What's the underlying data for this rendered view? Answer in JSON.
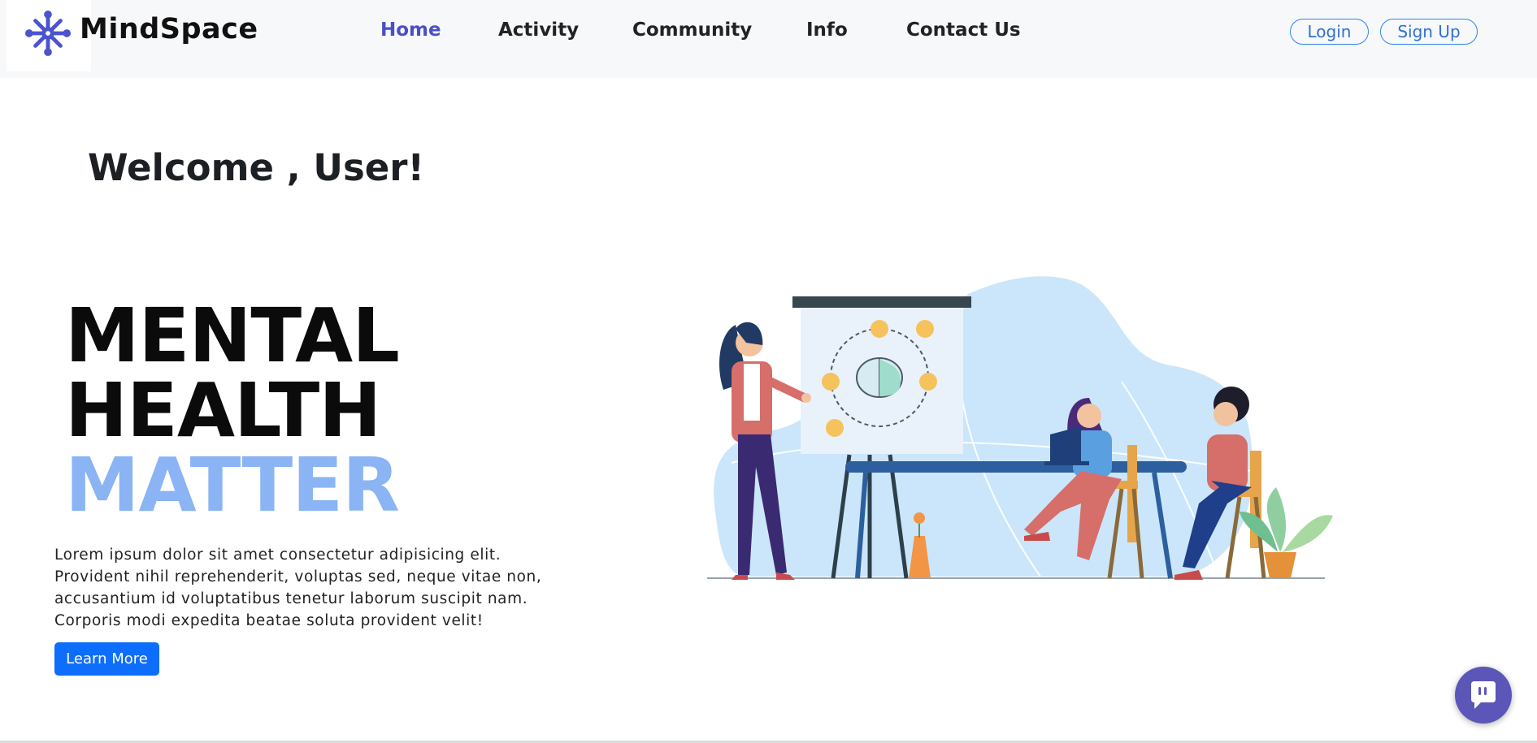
{
  "navbar": {
    "brand": "MindSpace",
    "logo_icon": "snowflake-icon",
    "links": [
      {
        "label": "Home",
        "active": true
      },
      {
        "label": "Activity",
        "active": false
      },
      {
        "label": "Community",
        "active": false
      },
      {
        "label": "Info",
        "active": false
      },
      {
        "label": "Contact Us",
        "active": false
      }
    ],
    "login_label": "Login",
    "signup_label": "Sign Up"
  },
  "main": {
    "welcome": "Welcome , User!",
    "headline": [
      "MENTAL",
      "HEALTH",
      "MATTER"
    ],
    "body_lines": [
      "Lorem ipsum dolor sit amet consectetur adipisicing elit.",
      "Provident nihil reprehenderit, voluptas sed, neque vitae non,",
      "accusantium id voluptatibus tenetur laborum suscipit nam.",
      "Corporis modi expedita beatae soluta provident velit!"
    ],
    "learn_more_label": "Learn More",
    "illustration": "team-meeting-illustration"
  },
  "chat": {
    "icon": "chat-bubble-icon"
  },
  "colors": {
    "brand_accent": "#4a4fc7",
    "headline_accent": "#8ab4f3",
    "primary_button": "#0d6efd",
    "auth_border": "#2f86e8",
    "chat_button": "#5b56b8"
  }
}
